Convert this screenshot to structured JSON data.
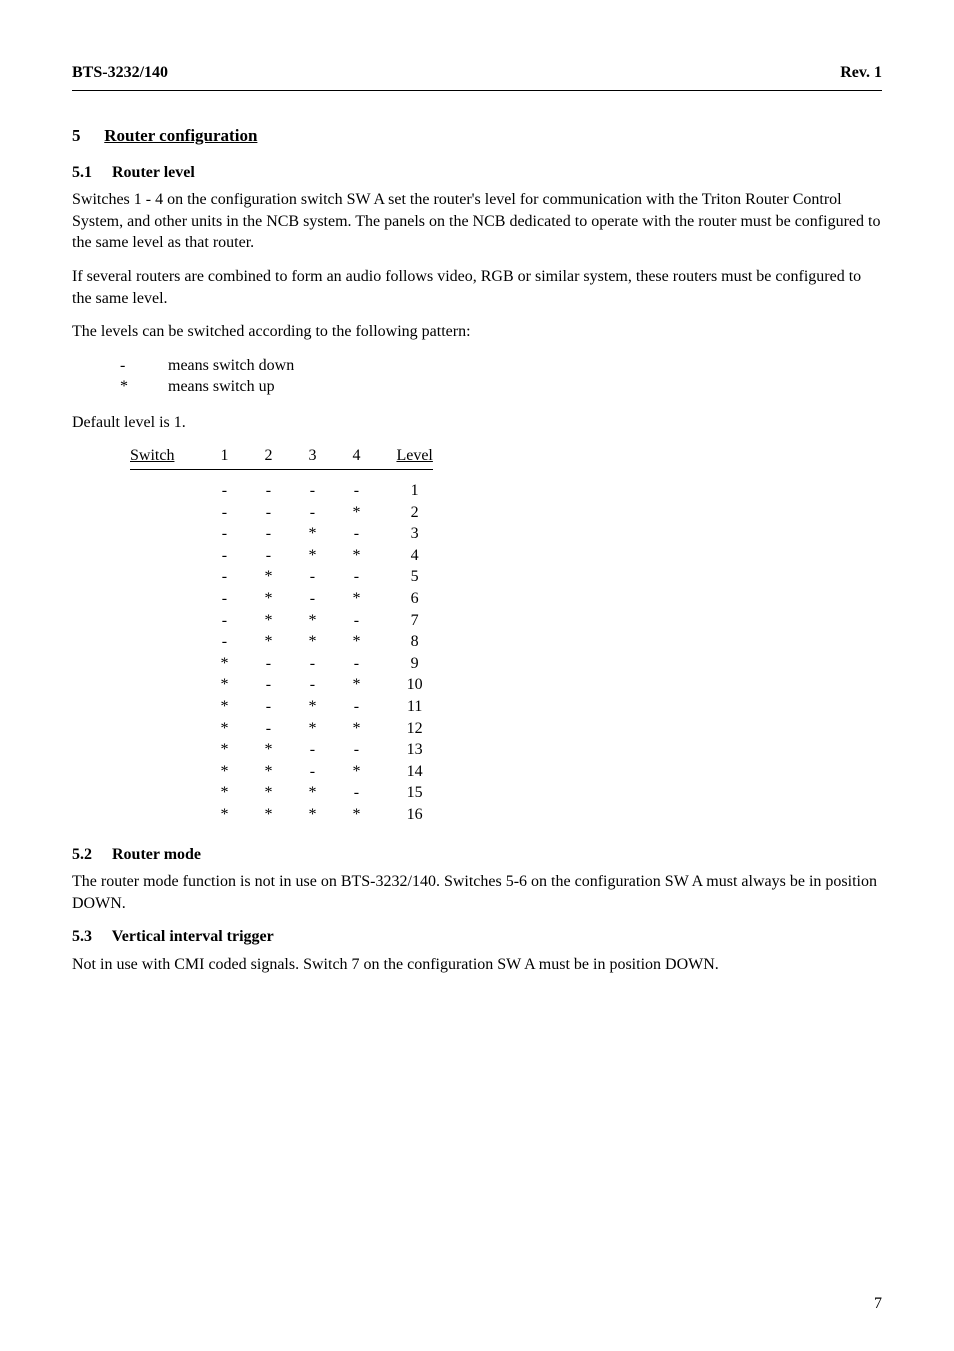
{
  "header": {
    "left": "BTS-3232/140",
    "right": "Rev. 1"
  },
  "section": {
    "number": "5",
    "title": "Router configuration"
  },
  "sub_5_1": {
    "number": "5.1",
    "title": "Router level",
    "para1": "Switches 1 - 4 on the configuration switch SW A set the router's level for communication with the Triton Router Control System, and other units in the NCB system. The panels on the NCB dedicated to operate with the router must be configured to the same level as that router.",
    "para2": "If several routers are combined to form an audio follows video, RGB or similar system, these routers must be configured to the same level.",
    "para3": "The levels can be switched according to the following pattern:",
    "legend_down_sym": "-",
    "legend_down_txt": "means switch down",
    "legend_up_sym": "*",
    "legend_up_txt": "means switch up",
    "default_txt": "Default level is 1."
  },
  "chart_data": {
    "type": "table",
    "title": "Switch level encoding",
    "columns": [
      "Switch",
      "1",
      "2",
      "3",
      "4",
      "Level"
    ],
    "rows": [
      [
        "-",
        "-",
        "-",
        "-",
        "1"
      ],
      [
        "-",
        "-",
        "-",
        "*",
        "2"
      ],
      [
        "-",
        "-",
        "*",
        "-",
        "3"
      ],
      [
        "-",
        "-",
        "*",
        "*",
        "4"
      ],
      [
        "-",
        "*",
        "-",
        "-",
        "5"
      ],
      [
        "-",
        "*",
        "-",
        "*",
        "6"
      ],
      [
        "-",
        "*",
        "*",
        "-",
        "7"
      ],
      [
        "-",
        "*",
        "*",
        "*",
        "8"
      ],
      [
        "*",
        "-",
        "-",
        "-",
        "9"
      ],
      [
        "*",
        "-",
        "-",
        "*",
        "10"
      ],
      [
        "*",
        "-",
        "*",
        "-",
        "11"
      ],
      [
        "*",
        "-",
        "*",
        "*",
        "12"
      ],
      [
        "*",
        "*",
        "-",
        "-",
        "13"
      ],
      [
        "*",
        "*",
        "-",
        "*",
        "14"
      ],
      [
        "*",
        "*",
        "*",
        "-",
        "15"
      ],
      [
        "*",
        "*",
        "*",
        "*",
        "16"
      ]
    ]
  },
  "sub_5_2": {
    "number": "5.2",
    "title": "Router mode",
    "para": "The router mode function is not in use on BTS-3232/140. Switches 5-6 on the configuration SW A must always be in position DOWN."
  },
  "sub_5_3": {
    "number": "5.3",
    "title": "Vertical interval trigger",
    "para": "Not in use with CMI coded signals. Switch 7 on the configuration SW A must be in position DOWN."
  },
  "page_number": "7"
}
